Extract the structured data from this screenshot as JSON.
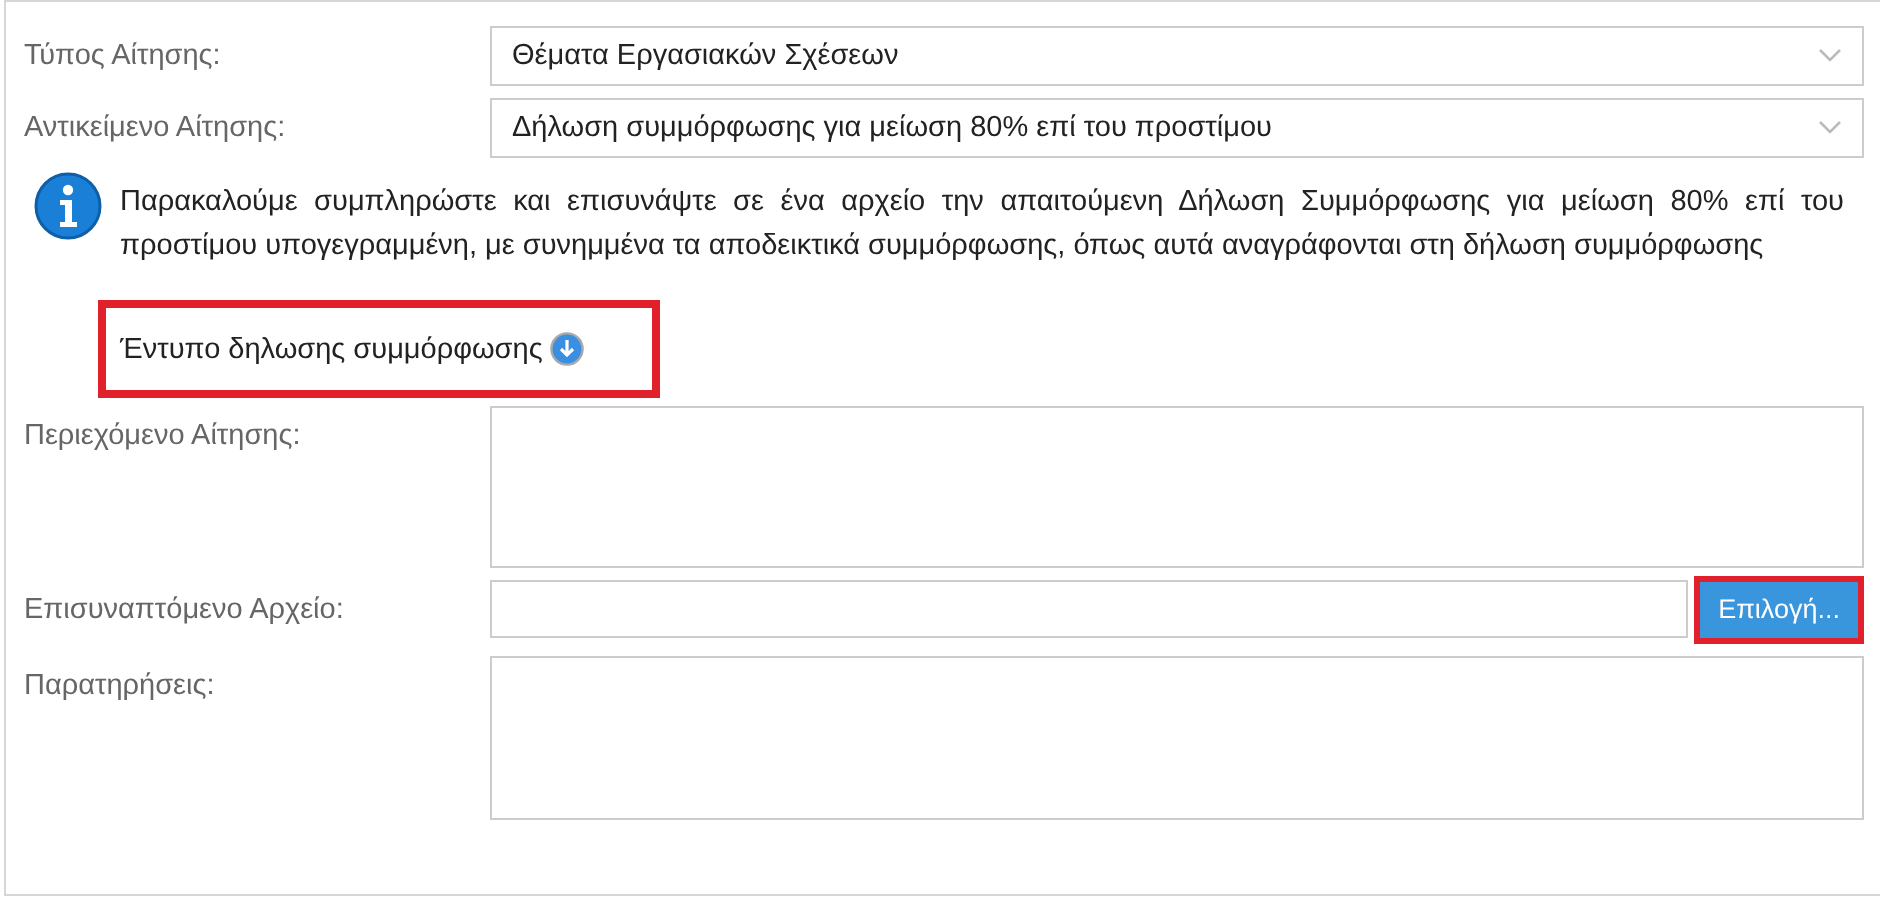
{
  "form_top": [
    {
      "kind": "select",
      "label": "Τύπος Αίτησης:",
      "value": "Θέματα Εργασιακών Σχέσεων"
    },
    {
      "kind": "select",
      "label": "Αντικείμενο Αίτησης:",
      "value": "Δήλωση συμμόρφωσης για μείωση 80% επί του προστίμου"
    }
  ],
  "info": {
    "text": "Παρακαλούμε συμπληρώστε και επισυνάψτε σε ένα αρχείο την απαιτούμενη Δήλωση Συμμόρφωσης για μείωση 80% επί του προστίμου υπογεγραμμένη, με συνημμένα τα αποδεικτικά συμμόρφωσης, όπως αυτά αναγράφονται στη δήλωση συμμόρφωσης"
  },
  "download_link": {
    "text": "Έντυπο δηλωσης συμμόρφωσης",
    "highlighted": true
  },
  "form_bottom": [
    {
      "kind": "textarea",
      "label": "Περιεχόμενο Αίτησης:"
    },
    {
      "kind": "file",
      "label": "Επισυναπτόμενο Αρχείο:",
      "button": "Επιλογή...",
      "highlighted": true
    },
    {
      "kind": "textarea",
      "label": "Παρατηρήσεις:"
    }
  ]
}
